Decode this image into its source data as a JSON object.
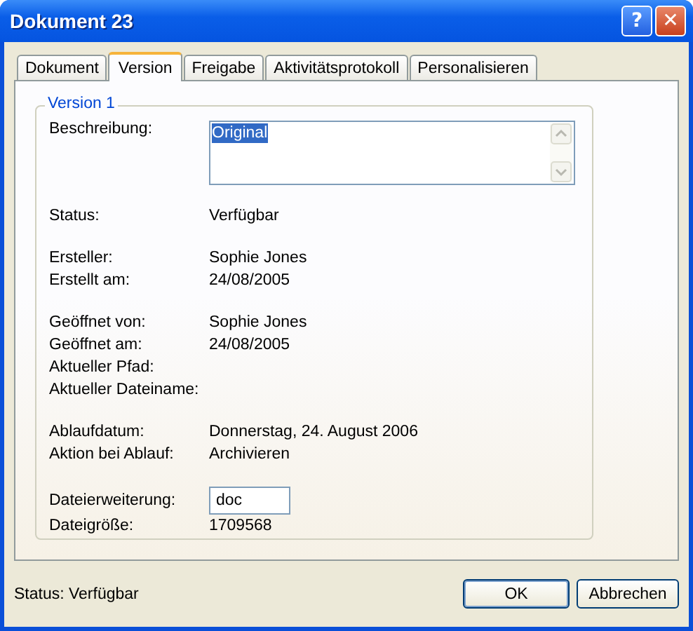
{
  "window": {
    "title": "Dokument 23",
    "buttons": [
      {
        "kind": "help",
        "label": "?"
      },
      {
        "kind": "close",
        "label": "✕"
      }
    ]
  },
  "tabs": [
    {
      "label": "Dokument",
      "selected": false
    },
    {
      "label": "Version",
      "selected": true
    },
    {
      "label": "Freigabe",
      "selected": false
    },
    {
      "label": "Aktivitätsprotokoll",
      "selected": false
    },
    {
      "label": "Personalisieren",
      "selected": false
    }
  ],
  "group": {
    "title": "Version 1",
    "sections": [
      [
        {
          "kind": "textarea",
          "label": "Beschreibung:",
          "value": "Original",
          "value_selected": true
        }
      ],
      [
        {
          "kind": "text",
          "label": "Status:",
          "value": "Verfügbar"
        }
      ],
      [
        {
          "kind": "text",
          "label": "Ersteller:",
          "value": "Sophie Jones"
        },
        {
          "kind": "text",
          "label": "Erstellt am:",
          "value": "24/08/2005"
        }
      ],
      [
        {
          "kind": "text",
          "label": "Geöffnet von:",
          "value": "Sophie Jones"
        },
        {
          "kind": "text",
          "label": "Geöffnet am:",
          "value": "24/08/2005"
        },
        {
          "kind": "text",
          "label": "Aktueller Pfad:"
        },
        {
          "kind": "text",
          "label": "Aktueller Dateiname:"
        }
      ],
      [
        {
          "kind": "text",
          "label": "Ablaufdatum:",
          "value": "Donnerstag, 24. August 2006"
        },
        {
          "kind": "text",
          "label": "Aktion bei Ablauf:",
          "value": "Archivieren"
        }
      ],
      [
        {
          "kind": "input",
          "label": "Dateierweiterung:",
          "value": "doc"
        },
        {
          "kind": "text",
          "label": "Dateigröße:",
          "value": "1709568"
        }
      ]
    ]
  },
  "status_bar": "Status: Verfügbar",
  "buttons": [
    {
      "label": "OK",
      "default": true
    },
    {
      "label": "Abbrechen",
      "default": false
    }
  ]
}
